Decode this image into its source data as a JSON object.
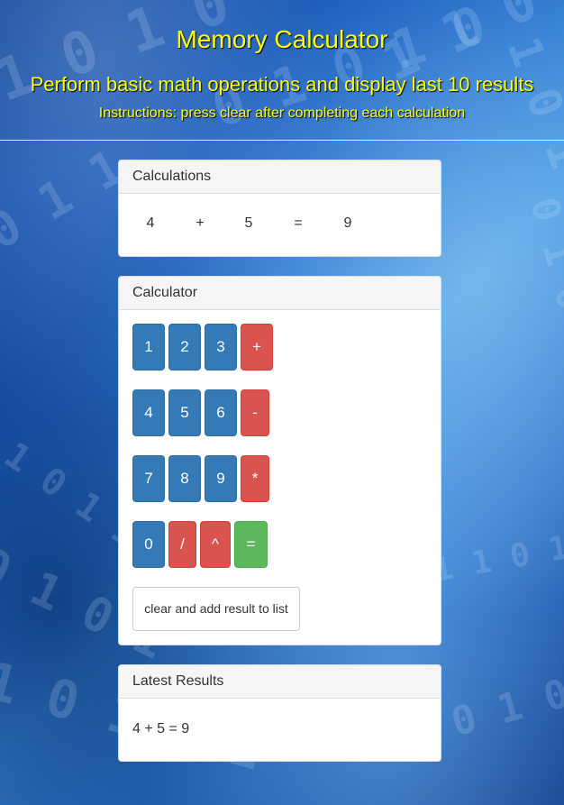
{
  "header": {
    "title": "Memory Calculator",
    "subtitle": "Perform basic math operations and display last 10 results",
    "instructions": "Instructions: press clear after completing each calculation"
  },
  "panels": {
    "calculations": {
      "heading": "Calculations",
      "operand1": "4",
      "operator": "+",
      "operand2": "5",
      "equals": "=",
      "result": "9"
    },
    "calculator": {
      "heading": "Calculator",
      "buttons": {
        "b1": "1",
        "b2": "2",
        "b3": "3",
        "plus": "+",
        "b4": "4",
        "b5": "5",
        "b6": "6",
        "minus": "-",
        "b7": "7",
        "b8": "8",
        "b9": "9",
        "multiply": "*",
        "b0": "0",
        "divide": "/",
        "power": "^",
        "equals": "="
      },
      "clear_label": "clear and add result to list"
    },
    "results": {
      "heading": "Latest Results",
      "items": [
        "4 + 5 = 9"
      ]
    }
  },
  "colors": {
    "title_text": "#ffff00",
    "number_button": "#337ab7",
    "operator_button": "#d9534f",
    "equals_button": "#5cb85c"
  }
}
